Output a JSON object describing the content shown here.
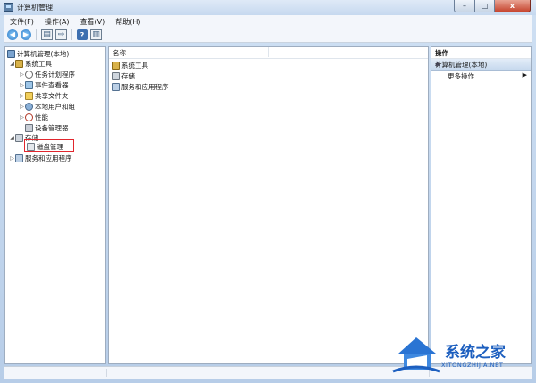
{
  "window": {
    "title": "计算机管理"
  },
  "window_buttons": {
    "minimize": "–",
    "maximize": "□",
    "close": "x"
  },
  "menu": [
    "文件(F)",
    "操作(A)",
    "查看(V)",
    "帮助(H)"
  ],
  "toolbar": {
    "back": "◀",
    "forward": "▶",
    "help": "?"
  },
  "tree": {
    "root": "计算机管理(本地)",
    "system_tools": "系统工具",
    "task_scheduler": "任务计划程序",
    "event_viewer": "事件查看器",
    "shared_folders": "共享文件夹",
    "local_users_groups": "本地用户和组",
    "performance": "性能",
    "device_manager": "设备管理器",
    "storage": "存储",
    "disk_management": "磁盘管理",
    "services_apps": "服务和应用程序"
  },
  "center": {
    "column_name": "名称",
    "items": [
      "系统工具",
      "存储",
      "服务和应用程序"
    ]
  },
  "actions": {
    "title": "操作",
    "section": "计算机管理(本地)",
    "more": "更多操作"
  },
  "watermark": {
    "brand": "系统之家",
    "url": "XITONGZHIJIA.NET"
  }
}
